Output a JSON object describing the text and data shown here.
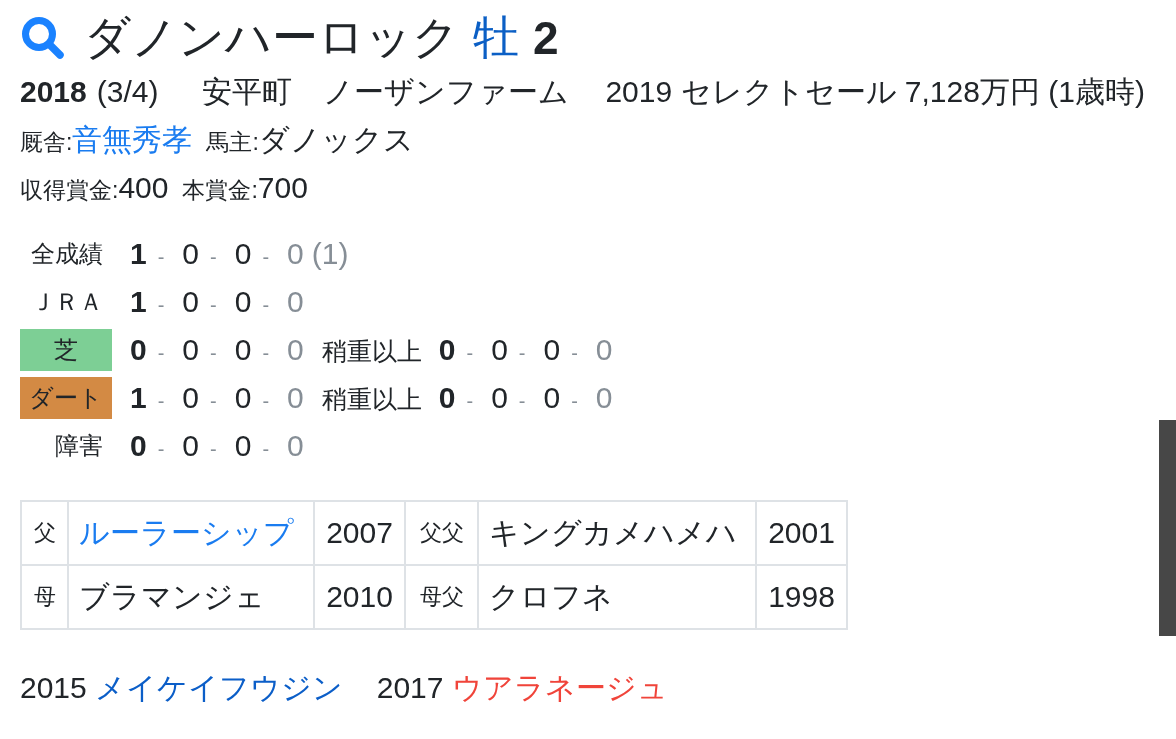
{
  "header": {
    "name": "ダノンハーロック",
    "sex": "牡",
    "age": "2"
  },
  "profile": {
    "birth_year": "2018",
    "birth_date": "(3/4)",
    "birthplace": "安平町",
    "breeder": "ノーザンファーム",
    "sale": "2019 セレクトセール 7,128万円 (1歳時)",
    "trainer_label": "厩舎:",
    "trainer": "音無秀孝",
    "owner_label": "馬主:",
    "owner": "ダノックス",
    "earnings": [
      {
        "label": "収得賞金:",
        "value": "400"
      },
      {
        "label": "本賞金:",
        "value": "700"
      }
    ]
  },
  "records": {
    "separator": "-",
    "rows": [
      {
        "kind": "plain",
        "label": "全成績",
        "results": [
          "1",
          "0",
          "0",
          "0"
        ],
        "note": "(1)"
      },
      {
        "kind": "plain",
        "label": "ＪＲＡ",
        "results": [
          "1",
          "0",
          "0",
          "0"
        ]
      },
      {
        "kind": "surface",
        "label": "芝",
        "color": "#7dcf95",
        "results": [
          "0",
          "0",
          "0",
          "0"
        ],
        "heavy": {
          "label": "稍重以上",
          "results": [
            "0",
            "0",
            "0",
            "0"
          ]
        }
      },
      {
        "kind": "surface",
        "label": "ダート",
        "color": "#d38a44",
        "results": [
          "1",
          "0",
          "0",
          "0"
        ],
        "heavy": {
          "label": "稍重以上",
          "results": [
            "0",
            "0",
            "0",
            "0"
          ]
        }
      },
      {
        "kind": "plain",
        "label": "障害",
        "results": [
          "0",
          "0",
          "0",
          "0"
        ]
      }
    ]
  },
  "pedigree": {
    "rows": [
      [
        {
          "kind": "relation",
          "text": "父"
        },
        {
          "kind": "horse",
          "text": "ルーラーシップ",
          "link": true
        },
        {
          "kind": "year",
          "text": "2007"
        },
        {
          "kind": "relation",
          "text": "父父"
        },
        {
          "kind": "horse",
          "text": "キングカメハメハ",
          "link": false
        },
        {
          "kind": "year",
          "text": "2001"
        }
      ],
      [
        {
          "kind": "relation",
          "text": "母"
        },
        {
          "kind": "horse",
          "text": "ブラマンジェ",
          "link": false
        },
        {
          "kind": "year",
          "text": "2010"
        },
        {
          "kind": "relation",
          "text": "母父"
        },
        {
          "kind": "horse",
          "text": "クロフネ",
          "link": false
        },
        {
          "kind": "year",
          "text": "1998"
        }
      ]
    ]
  },
  "siblings": [
    {
      "year": "2015",
      "name": "メイケイフウジン",
      "color": "#0b5ec8"
    },
    {
      "year": "2017",
      "name": "ウアラネージュ",
      "color": "#f0443a"
    }
  ]
}
